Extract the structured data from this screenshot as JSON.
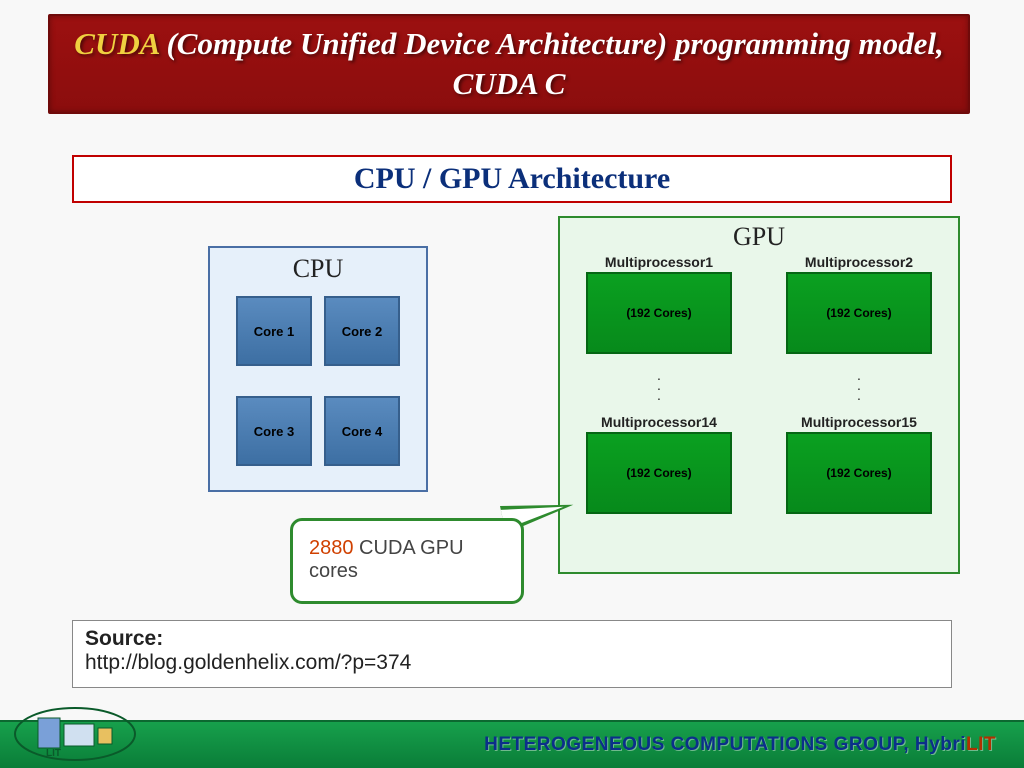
{
  "title": {
    "acronym": "CUDA",
    "expansion": " (Compute Unified Device Architecture) programming model, CUDA C"
  },
  "subheading": "CPU / GPU Architecture",
  "cpu": {
    "label": "CPU",
    "cores": [
      "Core 1",
      "Core 2",
      "Core 3",
      "Core 4"
    ]
  },
  "gpu": {
    "label": "GPU",
    "mp_top": [
      {
        "title": "Multiprocessor1",
        "cores": "(192 Cores)"
      },
      {
        "title": "Multiprocessor2",
        "cores": "(192 Cores)"
      }
    ],
    "mp_bottom": [
      {
        "title": "Multiprocessor14",
        "cores": "(192 Cores)"
      },
      {
        "title": "Multiprocessor15",
        "cores": "(192 Cores)"
      }
    ]
  },
  "callout": {
    "number": "2880",
    "text": " CUDA GPU cores"
  },
  "source": {
    "label": "Source:",
    "url": "http://blog.goldenhelix.com/?p=374"
  },
  "footer": {
    "group_text": "HETEROGENEOUS COMPUTATIONS GROUP,   ",
    "brand_hy": "Hybri",
    "brand_lit": "LIT"
  }
}
